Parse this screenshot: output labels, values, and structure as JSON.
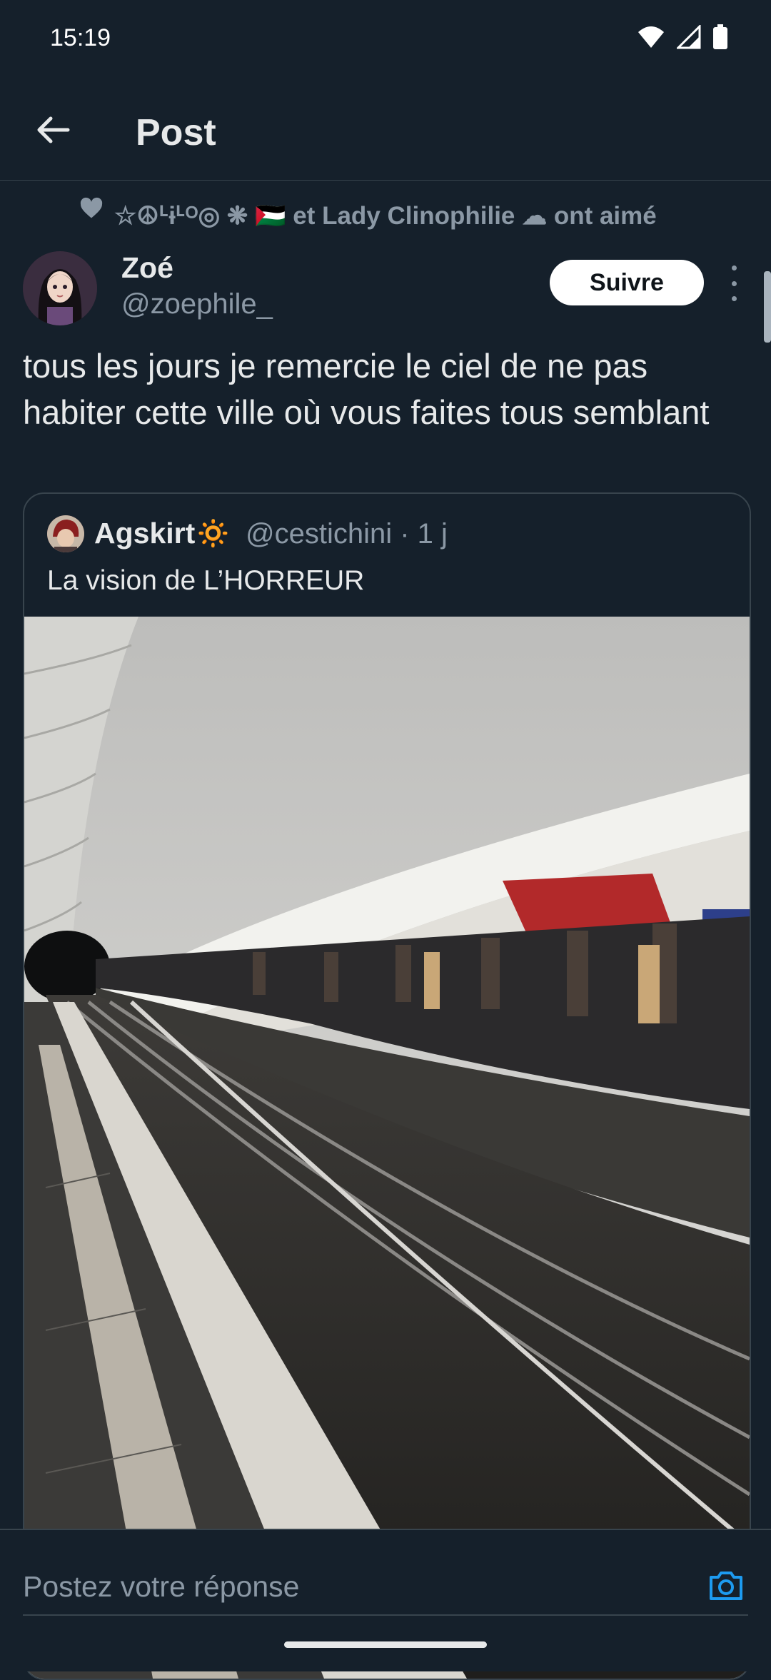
{
  "status_bar": {
    "time": "15:19"
  },
  "header": {
    "title": "Post"
  },
  "social_context": {
    "text": "☆☮ᒻɨᒻᴼ◎ ❋ 🇵🇸 et Lady Clinophilie ☁ ont aimé"
  },
  "post": {
    "author_name": "Zoé",
    "author_handle": "@zoephile_",
    "follow_label": "Suivre",
    "text": "tous les jours je remercie le ciel de ne pas habiter cette ville où vous faites tous semblant"
  },
  "quote": {
    "author_name": "Agskirt🔅",
    "author_handle": "@cestichini",
    "timestamp": "· 1 j",
    "text": "La vision de L’HORREUR"
  },
  "reply": {
    "placeholder": "Postez votre réponse"
  },
  "colors": {
    "background": "#15202b",
    "accent": "#1d9bf0",
    "muted": "#8b98a5",
    "border": "#38444d"
  },
  "icons": [
    "back-arrow-icon",
    "heart-icon",
    "more-icon",
    "camera-icon",
    "wifi-icon",
    "signal-icon",
    "battery-icon"
  ]
}
